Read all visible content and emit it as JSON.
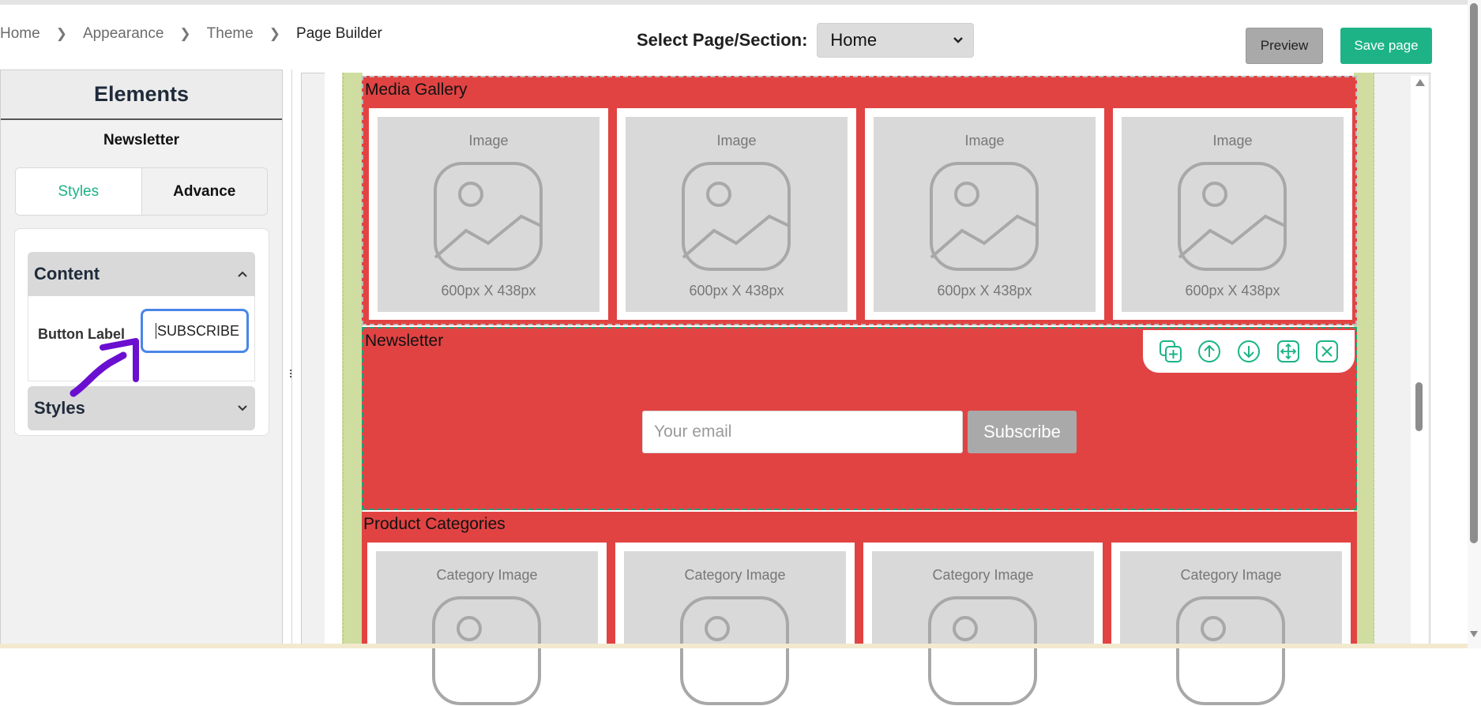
{
  "breadcrumb": [
    "Home",
    "Appearance",
    "Theme",
    "Page Builder"
  ],
  "header": {
    "select_label": "Select Page/Section:",
    "select_value": "Home",
    "preview_label": "Preview",
    "save_label": "Save page"
  },
  "colors": {
    "accent": "#1db386",
    "section_bg": "#e14343",
    "focus_border": "#4a86e8",
    "annotation_arrow": "#6a0fd0"
  },
  "panel": {
    "title": "Elements",
    "selected_element": "Newsletter",
    "tabs": [
      {
        "label": "Styles",
        "active": true
      },
      {
        "label": "Advance",
        "active": false
      }
    ],
    "content_section": {
      "title": "Content",
      "field_label": "Button Label",
      "field_value": "SUBSCRIBE"
    },
    "styles_section": {
      "title": "Styles"
    }
  },
  "canvas": {
    "media_gallery": {
      "title": "Media Gallery",
      "tiles": [
        {
          "label": "Image",
          "size": "600px X 438px"
        },
        {
          "label": "Image",
          "size": "600px X 438px"
        },
        {
          "label": "Image",
          "size": "600px X 438px"
        },
        {
          "label": "Image",
          "size": "600px X 438px"
        }
      ]
    },
    "newsletter": {
      "title": "Newsletter",
      "email_placeholder": "Your email",
      "button_label": "Subscribe",
      "toolbar_icons": [
        "duplicate-icon",
        "move-up-icon",
        "move-down-icon",
        "drag-move-icon",
        "close-icon"
      ]
    },
    "product_categories": {
      "title": "Product Categories",
      "tiles": [
        {
          "label": "Category Image"
        },
        {
          "label": "Category Image"
        },
        {
          "label": "Category Image"
        },
        {
          "label": "Category Image"
        }
      ]
    }
  }
}
